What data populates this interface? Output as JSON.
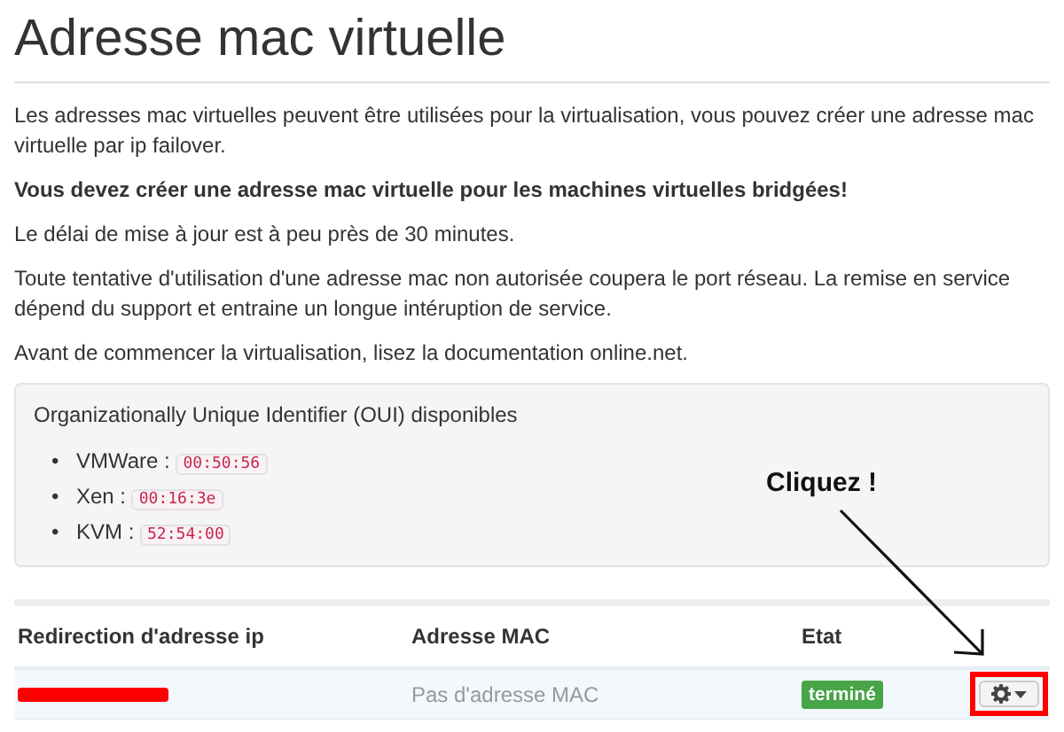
{
  "title": "Adresse mac virtuelle",
  "paragraphs": [
    {
      "text": "Les adresses mac virtuelles peuvent être utilisées pour la virtualisation, vous pouvez créer une adresse mac virtuelle par ip failover.",
      "bold": false
    },
    {
      "text": "Vous devez créer une adresse mac virtuelle pour les machines virtuelles bridgées!",
      "bold": true
    },
    {
      "text": "Le délai de mise à jour est à peu près de 30 minutes.",
      "bold": false
    },
    {
      "text": "Toute tentative d'utilisation d'une adresse mac non autorisée coupera le port réseau. La remise en service dépend du support et entraine un longue intéruption de service.",
      "bold": false
    },
    {
      "text": "Avant de commencer la virtualisation, lisez la documentation online.net.",
      "bold": false
    }
  ],
  "oui_box": {
    "heading": "Organizationally Unique Identifier (OUI) disponibles",
    "items": [
      {
        "bullet": "•",
        "label": "VMWare :",
        "code": "00:50:56"
      },
      {
        "bullet": "•",
        "label": "Xen :",
        "code": "00:16:3e"
      },
      {
        "bullet": "•",
        "label": "KVM :",
        "code": "52:54:00"
      }
    ]
  },
  "table": {
    "columns": [
      "Redirection d'adresse ip",
      "Adresse MAC",
      "Etat"
    ],
    "rows": [
      {
        "ip_redacted": true,
        "mac": "Pas d'adresse MAC",
        "status": "terminé",
        "color": "#47a447"
      }
    ]
  },
  "annotation": {
    "text": "Cliquez !"
  }
}
